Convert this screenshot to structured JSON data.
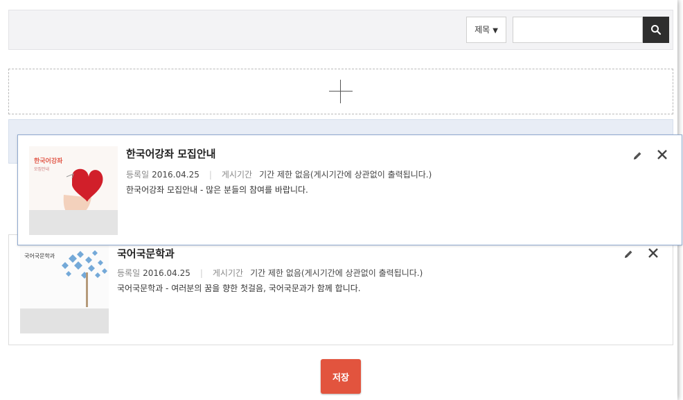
{
  "search": {
    "field_selected": "제목",
    "field_arrow": "▼",
    "input_value": "",
    "button_icon": "search-icon"
  },
  "add_zone": {
    "icon": "plus-icon"
  },
  "items": [
    {
      "title": "한국어강좌 모집안내",
      "reg_label": "등록일",
      "reg_date": "2016.04.25",
      "period_label": "게시기간",
      "period_value": "기간 제한 없음(게시기간에 상관없이 출력됩니다.)",
      "description": "한국어강좌 모집안내 - 많은 분들의 참여를 바랍니다.",
      "thumb_title": "한국어강좌",
      "thumb_sub": "모집안내"
    },
    {
      "title": "국어국문학과",
      "reg_label": "등록일",
      "reg_date": "2016.04.25",
      "period_label": "게시기간",
      "period_value": "기간 제한 없음(게시기간에 상관없이 출력됩니다.)",
      "description": "국어국문학과 - 여러분의 꿈을 향한 첫걸음, 국어국문과가 함께 합니다.",
      "thumb_title": "국어국문학과"
    }
  ],
  "footer": {
    "save_label": "저장"
  },
  "colors": {
    "accent": "#e2543e",
    "drag_border": "#8fa9cf",
    "placeholder": "#e8edf6"
  }
}
